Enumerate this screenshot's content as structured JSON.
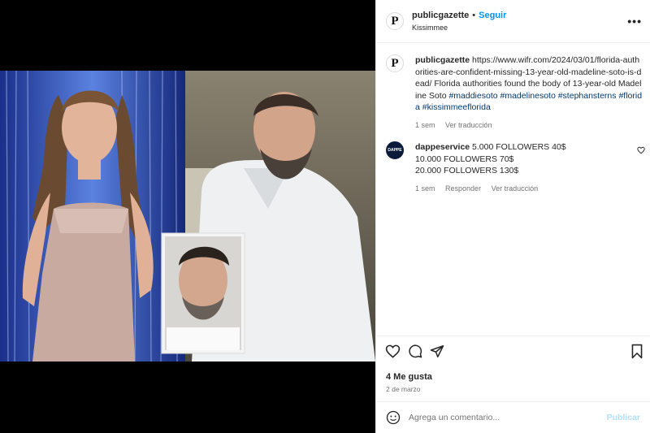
{
  "post": {
    "username": "publicgazette",
    "separator": "•",
    "follow_label": "Seguir",
    "location": "Kissimmee",
    "more_label": "•••"
  },
  "caption": {
    "username": "publicgazette",
    "text": "https://www.wifr.com/2024/03/01/florida-authorities-are-confident-missing-13-year-old-madeline-soto-is-dead/ Florida authorities found the body of 13-year-old Madeline Soto",
    "hashtags": [
      "#maddiesoto",
      "#madelinesoto",
      "#stephansterns",
      "#florida",
      "#kissimmeeflorida"
    ],
    "time": "1 sem",
    "translate": "Ver traducción"
  },
  "comment": {
    "username": "dappeservice",
    "avatar_text": "DAPPE",
    "line1": "5.000 FOLLOWERS 40$",
    "line2": "10.000 FOLLOWERS 70$",
    "line3": "20.000 FOLLOWERS 130$",
    "time": "1 sem",
    "reply": "Responder",
    "translate": "Ver traducción"
  },
  "logo_letter": "P",
  "likes": "4 Me gusta",
  "date": "2 de marzo",
  "composer": {
    "placeholder": "Agrega un comentario...",
    "publish": "Publicar"
  }
}
